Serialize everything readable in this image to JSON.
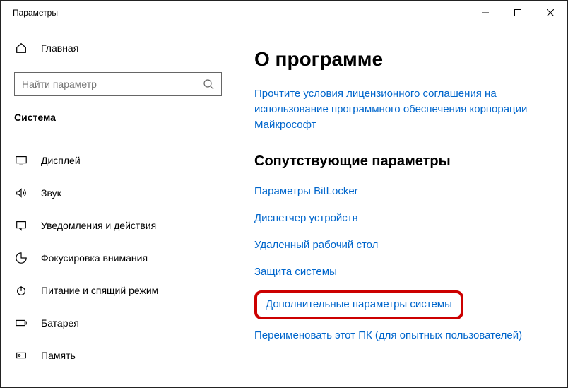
{
  "window": {
    "title": "Параметры"
  },
  "sidebar": {
    "home": "Главная",
    "search_placeholder": "Найти параметр",
    "section_title": "Система",
    "items": [
      {
        "label": "Дисплей",
        "icon": "display-icon"
      },
      {
        "label": "Звук",
        "icon": "sound-icon"
      },
      {
        "label": "Уведомления и действия",
        "icon": "notifications-icon"
      },
      {
        "label": "Фокусировка внимания",
        "icon": "focus-icon"
      },
      {
        "label": "Питание и спящий режим",
        "icon": "power-icon"
      },
      {
        "label": "Батарея",
        "icon": "battery-icon"
      },
      {
        "label": "Память",
        "icon": "storage-icon"
      }
    ]
  },
  "main": {
    "heading": "О программе",
    "license_link": "Прочтите условия лицензионного соглашения на использование программного обеспечения корпорации Майкрософт",
    "related_heading": "Сопутствующие параметры",
    "links": {
      "bitlocker": "Параметры BitLocker",
      "devmgr": "Диспетчер устройств",
      "rdp": "Удаленный рабочий стол",
      "sysprotect": "Защита системы",
      "advanced": "Дополнительные параметры системы",
      "rename": "Переименовать этот ПК (для опытных пользователей)"
    }
  }
}
